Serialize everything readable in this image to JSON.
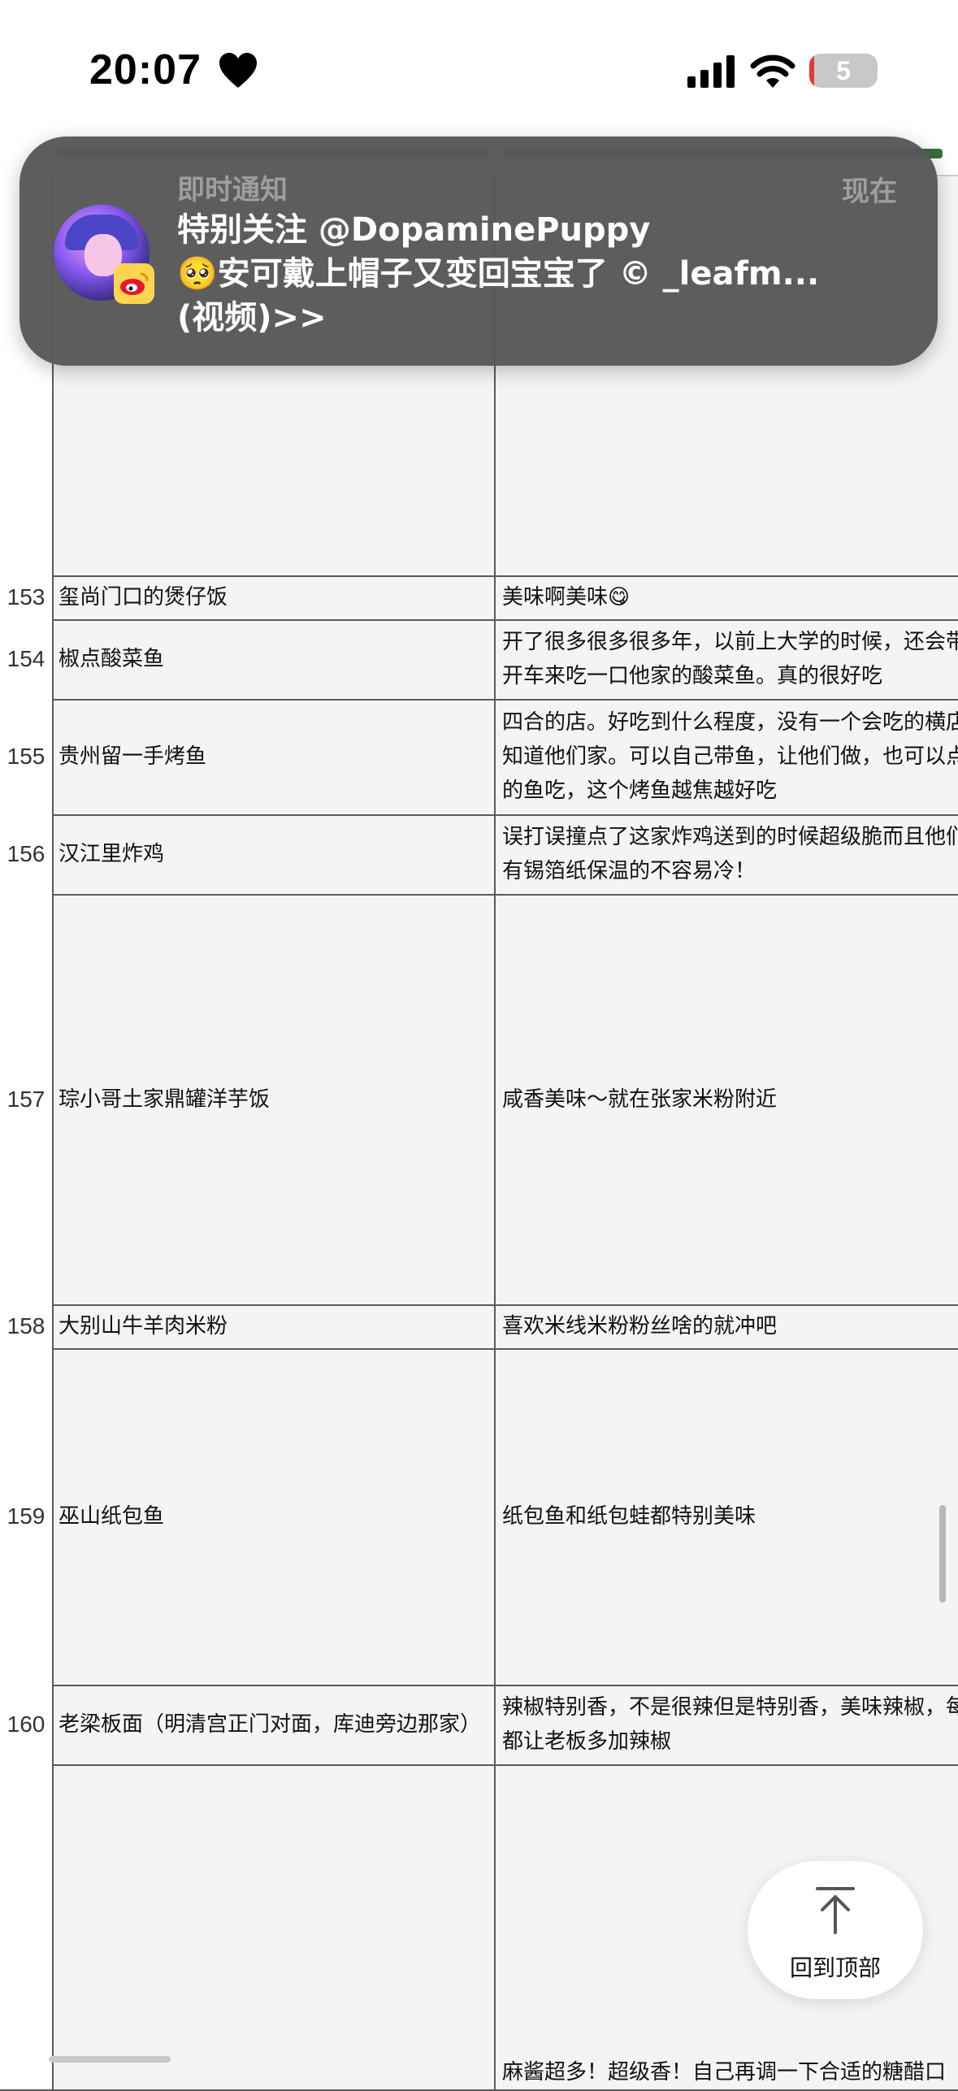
{
  "status_bar": {
    "time": "20:07",
    "battery_level": "5",
    "battery_fraction": 0.05,
    "icons": [
      "heart-icon",
      "cellular-signal-icon",
      "wifi-icon",
      "battery-icon"
    ]
  },
  "notification": {
    "app": "即时通知",
    "time": "现在",
    "title": "特别关注 @DopaminePuppy",
    "body": "🥺安可戴上帽子又变回宝宝了 © _leafm...",
    "body2": "(视频)>>",
    "app_icon": "weibo-icon"
  },
  "rows": [
    {
      "num": "153",
      "name": "玺尚门口的煲仔饭",
      "review": [
        "美味啊美味😋"
      ]
    },
    {
      "num": "154",
      "name": "椒点酸菜鱼",
      "review": [
        "开了很多很多很多年，以前上大学的时候，还会带",
        "开车来吃一口他家的酸菜鱼。真的很好吃"
      ]
    },
    {
      "num": "155",
      "name": "贵州留一手烤鱼",
      "review": [
        "四合的店。好吃到什么程度，没有一个会吃的横店",
        "知道他们家。可以自己带鱼，让他们做，也可以点",
        "的鱼吃，这个烤鱼越焦越好吃"
      ]
    },
    {
      "num": "156",
      "name": "汉江里炸鸡",
      "review": [
        "误打误撞点了这家炸鸡送到的时候超级脆而且他们",
        "有锡箔纸保温的不容易冷！"
      ]
    },
    {
      "num": "157",
      "name": "琮小哥土家鼎罐洋芋饭",
      "review": [
        "咸香美味～就在张家米粉附近"
      ]
    },
    {
      "num": "158",
      "name": "大别山牛羊肉米粉",
      "review": [
        "喜欢米线米粉粉丝啥的就冲吧"
      ]
    },
    {
      "num": "159",
      "name": "巫山纸包鱼",
      "review": [
        "纸包鱼和纸包蛙都特别美味"
      ]
    },
    {
      "num": "160",
      "name": "老梁板面（明清宫正门对面，库迪旁边那家）",
      "review": [
        "辣椒特别香，不是很辣但是特别香，美味辣椒，每",
        "都让老板多加辣椒"
      ]
    },
    {
      "num": "",
      "name": "",
      "review": [
        "麻酱超多！超级香！自己再调一下合适的糖醋口"
      ]
    }
  ],
  "back_to_top": {
    "label": "回到顶部",
    "icon": "arrow-up-icon"
  }
}
